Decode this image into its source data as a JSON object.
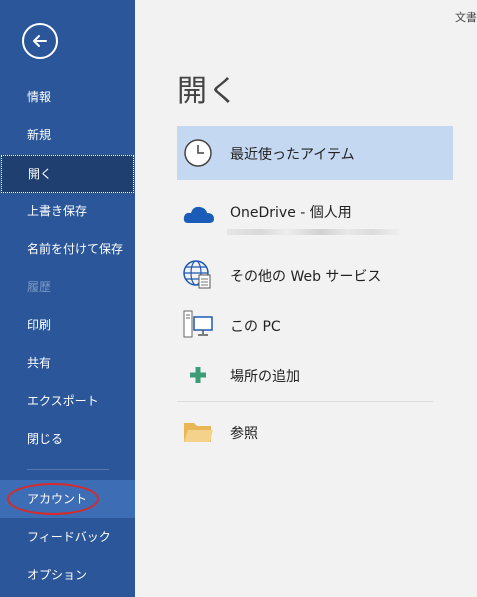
{
  "backstage": {
    "back_label": "戻る",
    "nav": [
      {
        "label": "情報"
      },
      {
        "label": "新規"
      },
      {
        "label": "開く"
      },
      {
        "label": "上書き保存"
      },
      {
        "label": "名前を付けて保存"
      },
      {
        "label": "履歴"
      },
      {
        "label": "印刷"
      },
      {
        "label": "共有"
      },
      {
        "label": "エクスポート"
      },
      {
        "label": "閉じる"
      },
      {
        "label": "アカウント"
      },
      {
        "label": "フィードバック"
      },
      {
        "label": "オプション"
      }
    ]
  },
  "header": {
    "doc_title": "文書"
  },
  "main": {
    "title": "開く",
    "locations": [
      {
        "label": "最近使ったアイテム",
        "icon": "clock-icon"
      },
      {
        "label": "OneDrive - 個人用",
        "icon": "cloud-icon"
      },
      {
        "label": "その他の Web サービス",
        "icon": "globe-icon"
      },
      {
        "label": "この PC",
        "icon": "pc-icon"
      },
      {
        "label": "場所の追加",
        "icon": "plus-icon"
      },
      {
        "label": "参照",
        "icon": "folder-icon"
      }
    ]
  },
  "colors": {
    "sidebar": "#2b579a",
    "sidebar_active": "#1e3f70",
    "selected_item": "#c5d8f1",
    "highlight_circle": "#d52b2b"
  }
}
